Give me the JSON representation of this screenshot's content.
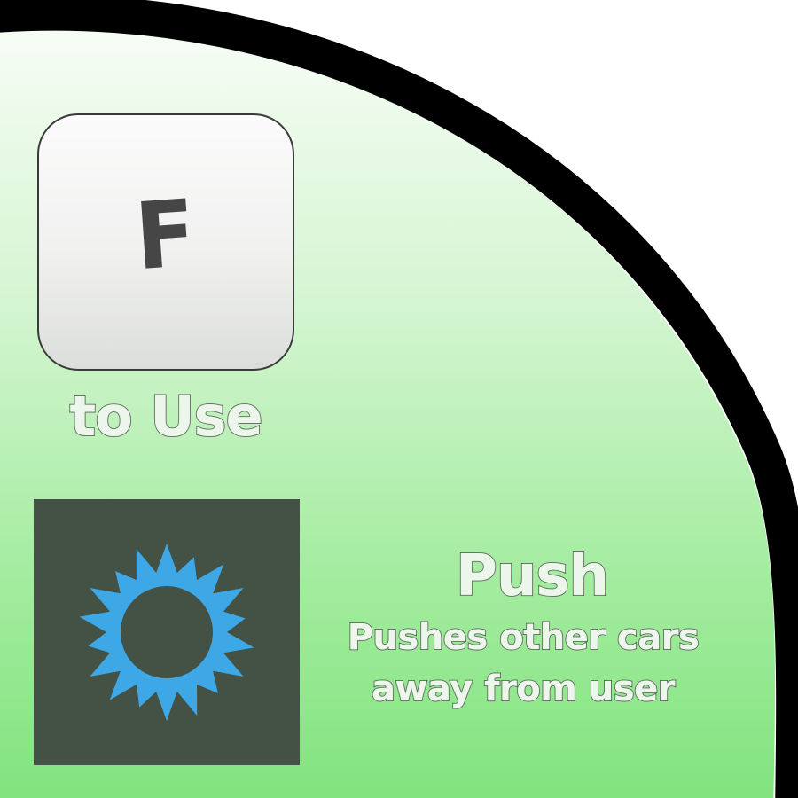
{
  "colors": {
    "panel_top": "#f2fbf1",
    "panel_bottom": "#7fe37b",
    "border": "#000000",
    "key_letter": "#464646",
    "tile_background": "#435244",
    "burst_icon": "#3ea8e6",
    "label_fill": "#ecf6ea",
    "label_outline": "#4f5b4f"
  },
  "key_hint": {
    "key": "F",
    "action_label": "to Use"
  },
  "ability": {
    "icon": "sunburst-push-icon",
    "name": "Push",
    "description_line1": "Pushes other cars",
    "description_line2": "away from user"
  }
}
